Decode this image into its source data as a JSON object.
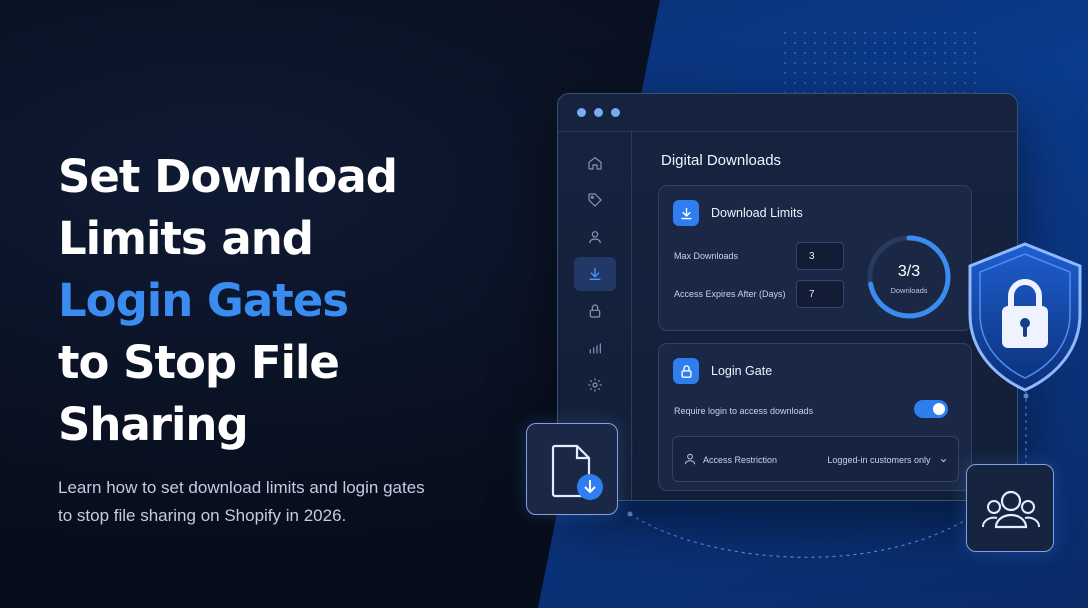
{
  "hero": {
    "line1": "Set Download",
    "line2": "Limits and",
    "line3_accent": "Login Gates",
    "line4": "to Stop File Sharing",
    "subtitle_line1": "Learn how to set download limits and login gates",
    "subtitle_line2": "to stop file sharing on Shopify in 2026."
  },
  "window": {
    "title": "Digital Downloads",
    "sidebar_icons": [
      "home-icon",
      "tag-icon",
      "user-icon",
      "download-icon",
      "lock-icon",
      "bar-chart-icon",
      "settings-icon"
    ],
    "active_sidebar_index": 3,
    "download_limits": {
      "title": "Download Limits",
      "max_downloads_label": "Max Downloads",
      "max_downloads_value": "3",
      "expires_label": "Access Expires After (Days)",
      "expires_value": "7",
      "ring_value": "3/3",
      "ring_caption": "Downloads",
      "ring_fraction": 0.72
    },
    "login_gate": {
      "title": "Login Gate",
      "require_login_label": "Require login to access downloads",
      "require_login_enabled": true,
      "restriction_label": "Access Restriction",
      "restriction_value": "Logged-in customers only"
    }
  },
  "colors": {
    "accent": "#3b8cf0",
    "toggle_on": "#2f7ef0"
  }
}
